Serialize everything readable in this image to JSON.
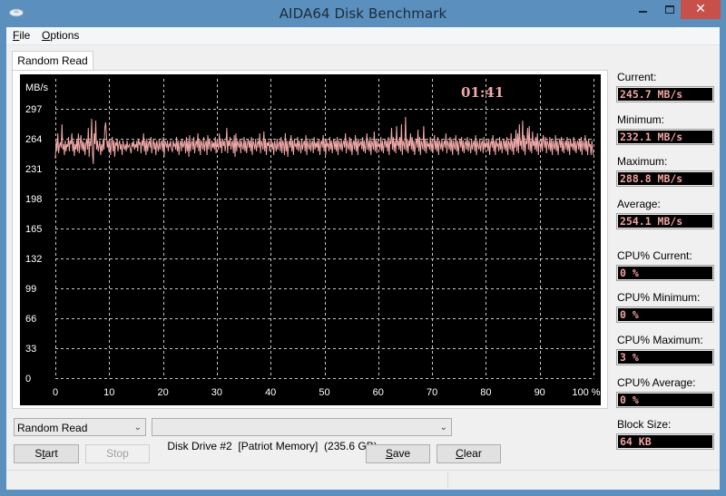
{
  "window": {
    "title": "AIDA64 Disk Benchmark",
    "icons": {
      "app": "disk-drive-icon",
      "minimize": "minimize-icon",
      "maximize": "maximize-icon",
      "close": "close-icon"
    },
    "close_glyph": "✕"
  },
  "menu": {
    "items": [
      {
        "label": "File",
        "accel": "F",
        "rest": "ile"
      },
      {
        "label": "Options",
        "accel": "O",
        "rest": "ptions"
      }
    ]
  },
  "tabs": [
    {
      "label": "Random Read",
      "active": true
    }
  ],
  "graph": {
    "timer": "01:41",
    "trace_color": "#f0a8a8",
    "grid_color": "#c8c8c8"
  },
  "chart_data": {
    "type": "line",
    "title": "",
    "xlabel": "%",
    "ylabel": "MB/s",
    "x_ticks": [
      "0",
      "10",
      "20",
      "30",
      "40",
      "50",
      "60",
      "70",
      "80",
      "90",
      "100 %"
    ],
    "y_ticks": [
      "0",
      "33",
      "66",
      "99",
      "132",
      "165",
      "198",
      "231",
      "264",
      "297"
    ],
    "y_unit_label": "MB/s",
    "xlim": [
      0,
      100
    ],
    "ylim": [
      0,
      330
    ],
    "grid": true,
    "series": [
      {
        "name": "Random Read",
        "x_range": [
          0,
          100
        ],
        "summary": {
          "current": 245.7,
          "min": 232.1,
          "max": 288.8,
          "avg": 254.1
        },
        "values": [
          242,
          262,
          250,
          270,
          248,
          256,
          260,
          254,
          280,
          252,
          258,
          246,
          262,
          250,
          258,
          255,
          266,
          250,
          262,
          258,
          270,
          250,
          262,
          245,
          258,
          252,
          264,
          250,
          270,
          248,
          258,
          268,
          252,
          262,
          250,
          260,
          246,
          258,
          264,
          252,
          276,
          244,
          262,
          256,
          286,
          248,
          236,
          270,
          258,
          284,
          252,
          262,
          250,
          256,
          262,
          246,
          258,
          250,
          264,
          252,
          276,
          282,
          268,
          254,
          262,
          250,
          264,
          246,
          258,
          266,
          250,
          262,
          244,
          260,
          256,
          264,
          250,
          258,
          262,
          252,
          258,
          246,
          262,
          256,
          252,
          258,
          250,
          262,
          254,
          256,
          258,
          252,
          248,
          260,
          255,
          262,
          252,
          258,
          254,
          262,
          250,
          264,
          258,
          260,
          248,
          262,
          256,
          270,
          250,
          262,
          246,
          264,
          250,
          258,
          262,
          254,
          266,
          248,
          258,
          264,
          252,
          260,
          246,
          262,
          256,
          250,
          264,
          252,
          258,
          262,
          250,
          266,
          244,
          262,
          258,
          254,
          262,
          250,
          258,
          256,
          262,
          252,
          250,
          262,
          256,
          258,
          252,
          266,
          250,
          262,
          246,
          258,
          262,
          250,
          264,
          254,
          258,
          262,
          248,
          266,
          250,
          262,
          244,
          268,
          250,
          258,
          262,
          252,
          266,
          248,
          258,
          262,
          254,
          270,
          250,
          264,
          246,
          262,
          258,
          252,
          266,
          250,
          258,
          262,
          246,
          268,
          252,
          264,
          258,
          250,
          262,
          254,
          260,
          252,
          266,
          248,
          262,
          258,
          252,
          270,
          254,
          262,
          248,
          264,
          256,
          262,
          250,
          258,
          276,
          248,
          262,
          256,
          266,
          252,
          258,
          262,
          248,
          268,
          244,
          270,
          250,
          262,
          258,
          254,
          264,
          248,
          262,
          256,
          252,
          266,
          250,
          262,
          248,
          258,
          264,
          254,
          262,
          250,
          266,
          246,
          262,
          258,
          252,
          264,
          250,
          258,
          262,
          254,
          270,
          248,
          262,
          258,
          252,
          272,
          250,
          264,
          246,
          260,
          256,
          262,
          250,
          258,
          264,
          252,
          260,
          246,
          262,
          256,
          250,
          264,
          252,
          258,
          262,
          250,
          266,
          248,
          262,
          258,
          246,
          270,
          250,
          262,
          244,
          258,
          262,
          254,
          268,
          250,
          262,
          246,
          264,
          256,
          258,
          252,
          266,
          250,
          262,
          256,
          248,
          264,
          252,
          258,
          262,
          250,
          268,
          246,
          262,
          256,
          252,
          264,
          250,
          258,
          262,
          248,
          266,
          252,
          260,
          254,
          262,
          250,
          264,
          246,
          258,
          262,
          254,
          268,
          250,
          262,
          246,
          264,
          256,
          258,
          250,
          266,
          252,
          262,
          248,
          258,
          264,
          252,
          262,
          250,
          266,
          246,
          262,
          258,
          252,
          264,
          250,
          258,
          262,
          254,
          270,
          248,
          262,
          256,
          252,
          266,
          250,
          264,
          246,
          258,
          262,
          252,
          268,
          250,
          262,
          246,
          264,
          256,
          258,
          262,
          252,
          266,
          250,
          262,
          248,
          258,
          270,
          252,
          262,
          250,
          266,
          246,
          262,
          258,
          252,
          272,
          250,
          264,
          248,
          262,
          256,
          258,
          252,
          266,
          250,
          262,
          248,
          258,
          264,
          254,
          262,
          250,
          266,
          246,
          262,
          258,
          276,
          252,
          266,
          250,
          262,
          248,
          278,
          256,
          262,
          252,
          266,
          250,
          280,
          246,
          262,
          258,
          252,
          288,
          250,
          264,
          248,
          262,
          256,
          270,
          252,
          266,
          250,
          262,
          246,
          258,
          264,
          254,
          274,
          250,
          266,
          246,
          262,
          258,
          252,
          278,
          250,
          264,
          248,
          262,
          256,
          258,
          252,
          266,
          250,
          262,
          248,
          258,
          268,
          252,
          262,
          250,
          266,
          246,
          262,
          258,
          252,
          264,
          250,
          258,
          262,
          254,
          270,
          248,
          262,
          258,
          252,
          266,
          250,
          264,
          246,
          262,
          256,
          252,
          268,
          250,
          262,
          246,
          258,
          264,
          254,
          266,
          250,
          262,
          248,
          258,
          262,
          252,
          266,
          250,
          262,
          256,
          248,
          264,
          252,
          258,
          262,
          250,
          268,
          246,
          262,
          256,
          252,
          264,
          250,
          258,
          262,
          248,
          266,
          252,
          260,
          254,
          262,
          250,
          264,
          246,
          258,
          262,
          254,
          268,
          250,
          262,
          246,
          264,
          256,
          258,
          250,
          266,
          252,
          262,
          248,
          258,
          264,
          252,
          262,
          250,
          266,
          246,
          262,
          258,
          252,
          270,
          250,
          262,
          246,
          264,
          254,
          274,
          250,
          270,
          248,
          280,
          256,
          262,
          252,
          284,
          250,
          268,
          246,
          262,
          258,
          276,
          252,
          278,
          250,
          262,
          248,
          272,
          256,
          262,
          252,
          266,
          250,
          270,
          246,
          262,
          258,
          252,
          264,
          250,
          268,
          262,
          254,
          266,
          248,
          262,
          258,
          252,
          266,
          250,
          264,
          246,
          262,
          256,
          252,
          268,
          250,
          262,
          246,
          258,
          264,
          254,
          266,
          250,
          262,
          248,
          258,
          262,
          252,
          266,
          250,
          262,
          246,
          264,
          256,
          258,
          252,
          266,
          250,
          262,
          248,
          258,
          262,
          252,
          264,
          250,
          266,
          246,
          262,
          258,
          252,
          268,
          250,
          262,
          246,
          264,
          256,
          258,
          246,
          262,
          250,
          246
        ]
      }
    ]
  },
  "stats": {
    "current": {
      "label": "Current:",
      "value": "245.7 MB/s"
    },
    "minimum": {
      "label": "Minimum:",
      "value": "232.1 MB/s"
    },
    "maximum": {
      "label": "Maximum:",
      "value": "288.8 MB/s"
    },
    "average": {
      "label": "Average:",
      "value": "254.1 MB/s"
    },
    "cpu_current": {
      "label": "CPU% Current:",
      "value": "0 %"
    },
    "cpu_minimum": {
      "label": "CPU% Minimum:",
      "value": "0 %"
    },
    "cpu_maximum": {
      "label": "CPU% Maximum:",
      "value": "3 %"
    },
    "cpu_average": {
      "label": "CPU% Average:",
      "value": "0 %"
    },
    "block_size": {
      "label": "Block Size:",
      "value": "64 KB"
    }
  },
  "controls": {
    "test_select": {
      "value": "Random Read"
    },
    "drive_select": {
      "value": "Disk Drive #2  [Patriot Memory]  (235.6 GB)"
    },
    "chevron": "⌄",
    "start": {
      "label": "Start",
      "accel": "S",
      "pre": "S",
      "a": "t",
      "post": "art",
      "enabled": true
    },
    "stop": {
      "label": "Stop",
      "enabled": false
    },
    "save": {
      "label": "Save",
      "accel": "S",
      "pre": "",
      "a": "S",
      "post": "ave",
      "enabled": true
    },
    "clear": {
      "label": "Clear",
      "accel": "C",
      "pre": "",
      "a": "C",
      "post": "lear",
      "enabled": true
    }
  }
}
